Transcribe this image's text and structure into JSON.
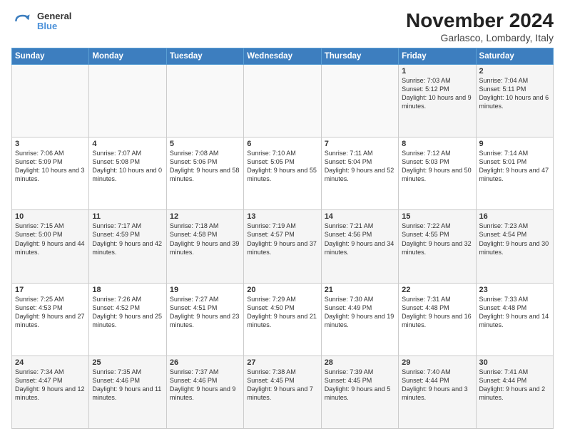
{
  "logo": {
    "general": "General",
    "blue": "Blue"
  },
  "title": "November 2024",
  "subtitle": "Garlasco, Lombardy, Italy",
  "days_header": [
    "Sunday",
    "Monday",
    "Tuesday",
    "Wednesday",
    "Thursday",
    "Friday",
    "Saturday"
  ],
  "weeks": [
    [
      {
        "day": "",
        "info": ""
      },
      {
        "day": "",
        "info": ""
      },
      {
        "day": "",
        "info": ""
      },
      {
        "day": "",
        "info": ""
      },
      {
        "day": "",
        "info": ""
      },
      {
        "day": "1",
        "info": "Sunrise: 7:03 AM\nSunset: 5:12 PM\nDaylight: 10 hours and 9 minutes."
      },
      {
        "day": "2",
        "info": "Sunrise: 7:04 AM\nSunset: 5:11 PM\nDaylight: 10 hours and 6 minutes."
      }
    ],
    [
      {
        "day": "3",
        "info": "Sunrise: 7:06 AM\nSunset: 5:09 PM\nDaylight: 10 hours and 3 minutes."
      },
      {
        "day": "4",
        "info": "Sunrise: 7:07 AM\nSunset: 5:08 PM\nDaylight: 10 hours and 0 minutes."
      },
      {
        "day": "5",
        "info": "Sunrise: 7:08 AM\nSunset: 5:06 PM\nDaylight: 9 hours and 58 minutes."
      },
      {
        "day": "6",
        "info": "Sunrise: 7:10 AM\nSunset: 5:05 PM\nDaylight: 9 hours and 55 minutes."
      },
      {
        "day": "7",
        "info": "Sunrise: 7:11 AM\nSunset: 5:04 PM\nDaylight: 9 hours and 52 minutes."
      },
      {
        "day": "8",
        "info": "Sunrise: 7:12 AM\nSunset: 5:03 PM\nDaylight: 9 hours and 50 minutes."
      },
      {
        "day": "9",
        "info": "Sunrise: 7:14 AM\nSunset: 5:01 PM\nDaylight: 9 hours and 47 minutes."
      }
    ],
    [
      {
        "day": "10",
        "info": "Sunrise: 7:15 AM\nSunset: 5:00 PM\nDaylight: 9 hours and 44 minutes."
      },
      {
        "day": "11",
        "info": "Sunrise: 7:17 AM\nSunset: 4:59 PM\nDaylight: 9 hours and 42 minutes."
      },
      {
        "day": "12",
        "info": "Sunrise: 7:18 AM\nSunset: 4:58 PM\nDaylight: 9 hours and 39 minutes."
      },
      {
        "day": "13",
        "info": "Sunrise: 7:19 AM\nSunset: 4:57 PM\nDaylight: 9 hours and 37 minutes."
      },
      {
        "day": "14",
        "info": "Sunrise: 7:21 AM\nSunset: 4:56 PM\nDaylight: 9 hours and 34 minutes."
      },
      {
        "day": "15",
        "info": "Sunrise: 7:22 AM\nSunset: 4:55 PM\nDaylight: 9 hours and 32 minutes."
      },
      {
        "day": "16",
        "info": "Sunrise: 7:23 AM\nSunset: 4:54 PM\nDaylight: 9 hours and 30 minutes."
      }
    ],
    [
      {
        "day": "17",
        "info": "Sunrise: 7:25 AM\nSunset: 4:53 PM\nDaylight: 9 hours and 27 minutes."
      },
      {
        "day": "18",
        "info": "Sunrise: 7:26 AM\nSunset: 4:52 PM\nDaylight: 9 hours and 25 minutes."
      },
      {
        "day": "19",
        "info": "Sunrise: 7:27 AM\nSunset: 4:51 PM\nDaylight: 9 hours and 23 minutes."
      },
      {
        "day": "20",
        "info": "Sunrise: 7:29 AM\nSunset: 4:50 PM\nDaylight: 9 hours and 21 minutes."
      },
      {
        "day": "21",
        "info": "Sunrise: 7:30 AM\nSunset: 4:49 PM\nDaylight: 9 hours and 19 minutes."
      },
      {
        "day": "22",
        "info": "Sunrise: 7:31 AM\nSunset: 4:48 PM\nDaylight: 9 hours and 16 minutes."
      },
      {
        "day": "23",
        "info": "Sunrise: 7:33 AM\nSunset: 4:48 PM\nDaylight: 9 hours and 14 minutes."
      }
    ],
    [
      {
        "day": "24",
        "info": "Sunrise: 7:34 AM\nSunset: 4:47 PM\nDaylight: 9 hours and 12 minutes."
      },
      {
        "day": "25",
        "info": "Sunrise: 7:35 AM\nSunset: 4:46 PM\nDaylight: 9 hours and 11 minutes."
      },
      {
        "day": "26",
        "info": "Sunrise: 7:37 AM\nSunset: 4:46 PM\nDaylight: 9 hours and 9 minutes."
      },
      {
        "day": "27",
        "info": "Sunrise: 7:38 AM\nSunset: 4:45 PM\nDaylight: 9 hours and 7 minutes."
      },
      {
        "day": "28",
        "info": "Sunrise: 7:39 AM\nSunset: 4:45 PM\nDaylight: 9 hours and 5 minutes."
      },
      {
        "day": "29",
        "info": "Sunrise: 7:40 AM\nSunset: 4:44 PM\nDaylight: 9 hours and 3 minutes."
      },
      {
        "day": "30",
        "info": "Sunrise: 7:41 AM\nSunset: 4:44 PM\nDaylight: 9 hours and 2 minutes."
      }
    ]
  ]
}
